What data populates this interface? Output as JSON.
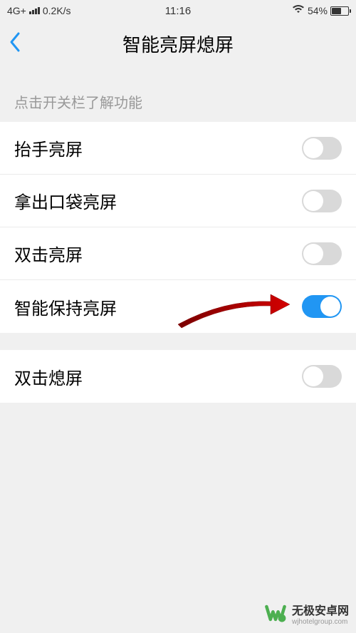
{
  "statusBar": {
    "network": "4G+",
    "speed": "0.2K/s",
    "time": "11:16",
    "batteryPercent": "54%"
  },
  "nav": {
    "title": "智能亮屏熄屏"
  },
  "sectionHeader": "点击开关栏了解功能",
  "settings": [
    {
      "label": "抬手亮屏",
      "on": false
    },
    {
      "label": "拿出口袋亮屏",
      "on": false
    },
    {
      "label": "双击亮屏",
      "on": false
    },
    {
      "label": "智能保持亮屏",
      "on": true
    }
  ],
  "settings2": [
    {
      "label": "双击熄屏",
      "on": false
    }
  ],
  "watermark": {
    "title": "无极安卓网",
    "url": "wjhotelgroup.com"
  }
}
